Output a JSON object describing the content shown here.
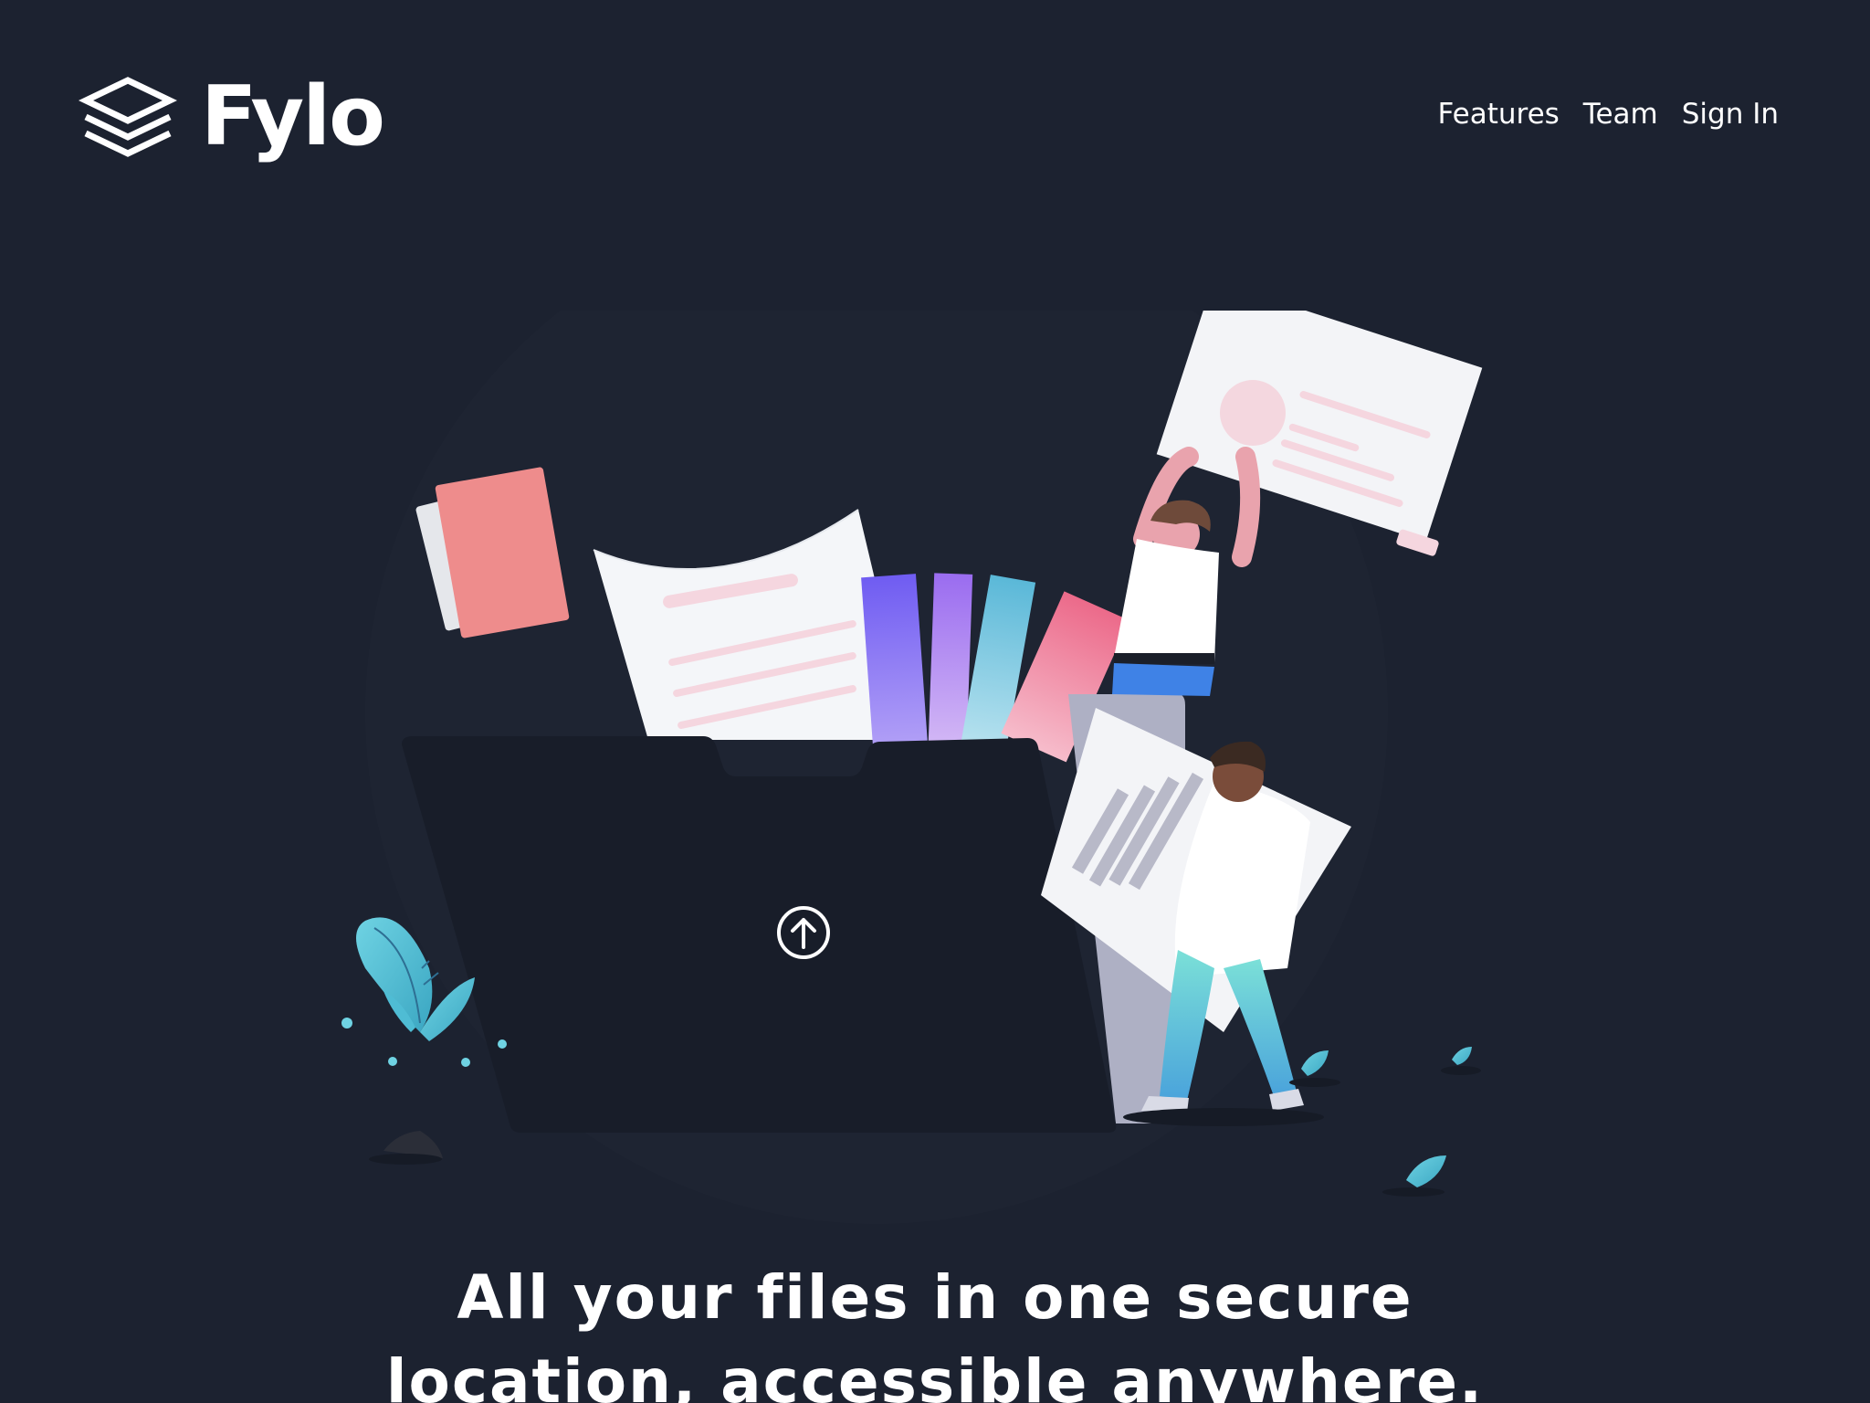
{
  "brand": {
    "name": "Fylo",
    "logo_icon": "layers-stack-icon"
  },
  "nav": {
    "items": [
      {
        "label": "Features"
      },
      {
        "label": "Team"
      },
      {
        "label": "Sign In"
      }
    ]
  },
  "hero": {
    "illustration_icon": "file-upload-illustration",
    "upload_icon": "arrow-up-circle-icon",
    "headline_line1": "All your files in one secure",
    "headline_line2": "location, accessible anywhere."
  },
  "colors": {
    "background": "#1c2230",
    "text": "#ffffff",
    "folder": "#181d29",
    "accent_teal": "#65d9e4",
    "accent_pink": "#f2a0b4"
  }
}
